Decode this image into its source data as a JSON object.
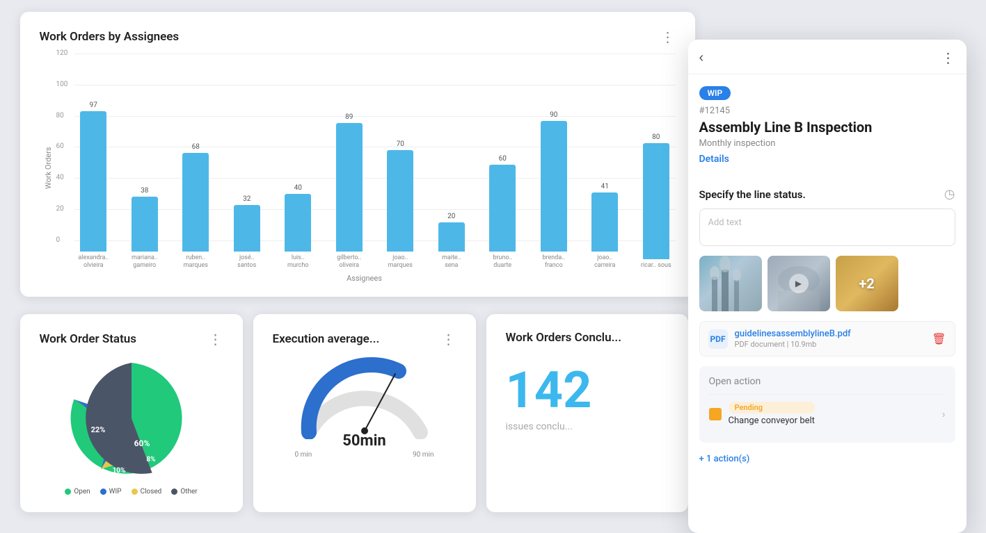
{
  "dashboard": {
    "topCard": {
      "title": "Work Orders by Assignees",
      "yAxisLabel": "Work Orders",
      "xAxisLabel": "Assignees",
      "yGridLines": [
        "120",
        "100",
        "80",
        "60",
        "40",
        "20",
        "0"
      ],
      "bars": [
        {
          "label": "alexandra.\nolvieira",
          "value": 97
        },
        {
          "label": "mariana.\ngameiro",
          "value": 38
        },
        {
          "label": "ruben.\nmarques",
          "value": 68
        },
        {
          "label": "josé.\nsantos",
          "value": 32
        },
        {
          "label": "luis.\nmurcho",
          "value": 40
        },
        {
          "label": "gilberto.\noliveira",
          "value": 89
        },
        {
          "label": "joao.\nmarques",
          "value": 70
        },
        {
          "label": "maite.\nsena",
          "value": 20
        },
        {
          "label": "bruno.\nduarte",
          "value": 60
        },
        {
          "label": "brenda.\nfranco",
          "value": 90
        },
        {
          "label": "joao.\ncarreira",
          "value": 41
        },
        {
          "label": "ricar.\nsous",
          "value": 80
        }
      ],
      "maxValue": 120
    },
    "statusCard": {
      "title": "Work Order Status",
      "segments": [
        {
          "label": "Open",
          "value": 60,
          "color": "#21c97a"
        },
        {
          "label": "WIP",
          "value": 22,
          "color": "#2c6fcc"
        },
        {
          "label": "Closed",
          "value": 10,
          "color": "#e8c84a"
        },
        {
          "label": "Other",
          "value": 8,
          "color": "#4a5568"
        }
      ],
      "percentages": [
        "60%",
        "22%",
        "10%",
        "8%"
      ]
    },
    "executionCard": {
      "title": "Execution average...",
      "gaugeMin": "0 min",
      "gaugeMax": "90 min",
      "gaugeValue": "50min",
      "gaugePercent": 56
    },
    "conclusionCard": {
      "title": "Work Orders Conclu...",
      "bigNumber": "142",
      "label": "issues conclu..."
    }
  },
  "panel": {
    "wipLabel": "WIP",
    "woNumber": "#12145",
    "woTitle": "Assembly Line B Inspection",
    "woSubtitle": "Monthly inspection",
    "detailsLink": "Details",
    "sectionTitle": "Specify the line status.",
    "textPlaceholder": "Add text",
    "file": {
      "name": "guidelinesassemblylineB.pdf",
      "type": "PDF document",
      "size": "10.9mb"
    },
    "openActionLabel": "Open action",
    "action": {
      "status": "Pending",
      "title": "Change conveyor belt"
    },
    "moreActions": "+ 1 action(s)"
  }
}
